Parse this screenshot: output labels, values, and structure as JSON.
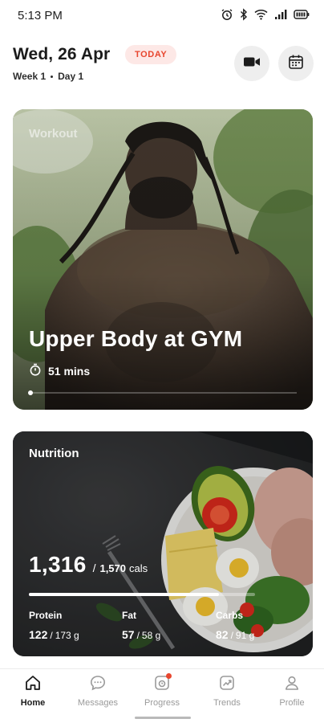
{
  "status_bar": {
    "time": "5:13 PM",
    "icons": [
      "alarm-icon",
      "bluetooth-icon",
      "wifi-icon",
      "signal-icon",
      "battery-icon"
    ]
  },
  "header": {
    "date": "Wed, 26 Apr",
    "today_badge": "TODAY",
    "week": "Week 1",
    "day": "Day 1",
    "actions": [
      "video-camera-icon",
      "calendar-icon"
    ]
  },
  "workout": {
    "label": "Workout",
    "title": "Upper Body at GYM",
    "duration": "51 mins",
    "duration_icon": "stopwatch-icon"
  },
  "nutrition": {
    "label": "Nutrition",
    "calories": "1,316",
    "calories_goal": "1,570",
    "calories_unit": "cals",
    "calorie_progress_fraction": 0.84,
    "macros": [
      {
        "label": "Protein",
        "value": "122",
        "goal": "173 g"
      },
      {
        "label": "Fat",
        "value": "57",
        "goal": "58 g"
      },
      {
        "label": "Carbs",
        "value": "82",
        "goal": "91 g"
      }
    ]
  },
  "bottom_nav": {
    "items": [
      {
        "label": "Home",
        "icon": "home-icon",
        "active": true
      },
      {
        "label": "Messages",
        "icon": "chat-icon",
        "active": false
      },
      {
        "label": "Progress",
        "icon": "progress-icon",
        "active": false,
        "badge": true
      },
      {
        "label": "Trends",
        "icon": "trends-icon",
        "active": false
      },
      {
        "label": "Profile",
        "icon": "profile-icon",
        "active": false
      }
    ]
  },
  "colors": {
    "accent": "#e8462e",
    "badge_bg": "#fde8e6",
    "text_primary": "#1b1b1b",
    "nav_inactive": "#9a9a9a"
  }
}
